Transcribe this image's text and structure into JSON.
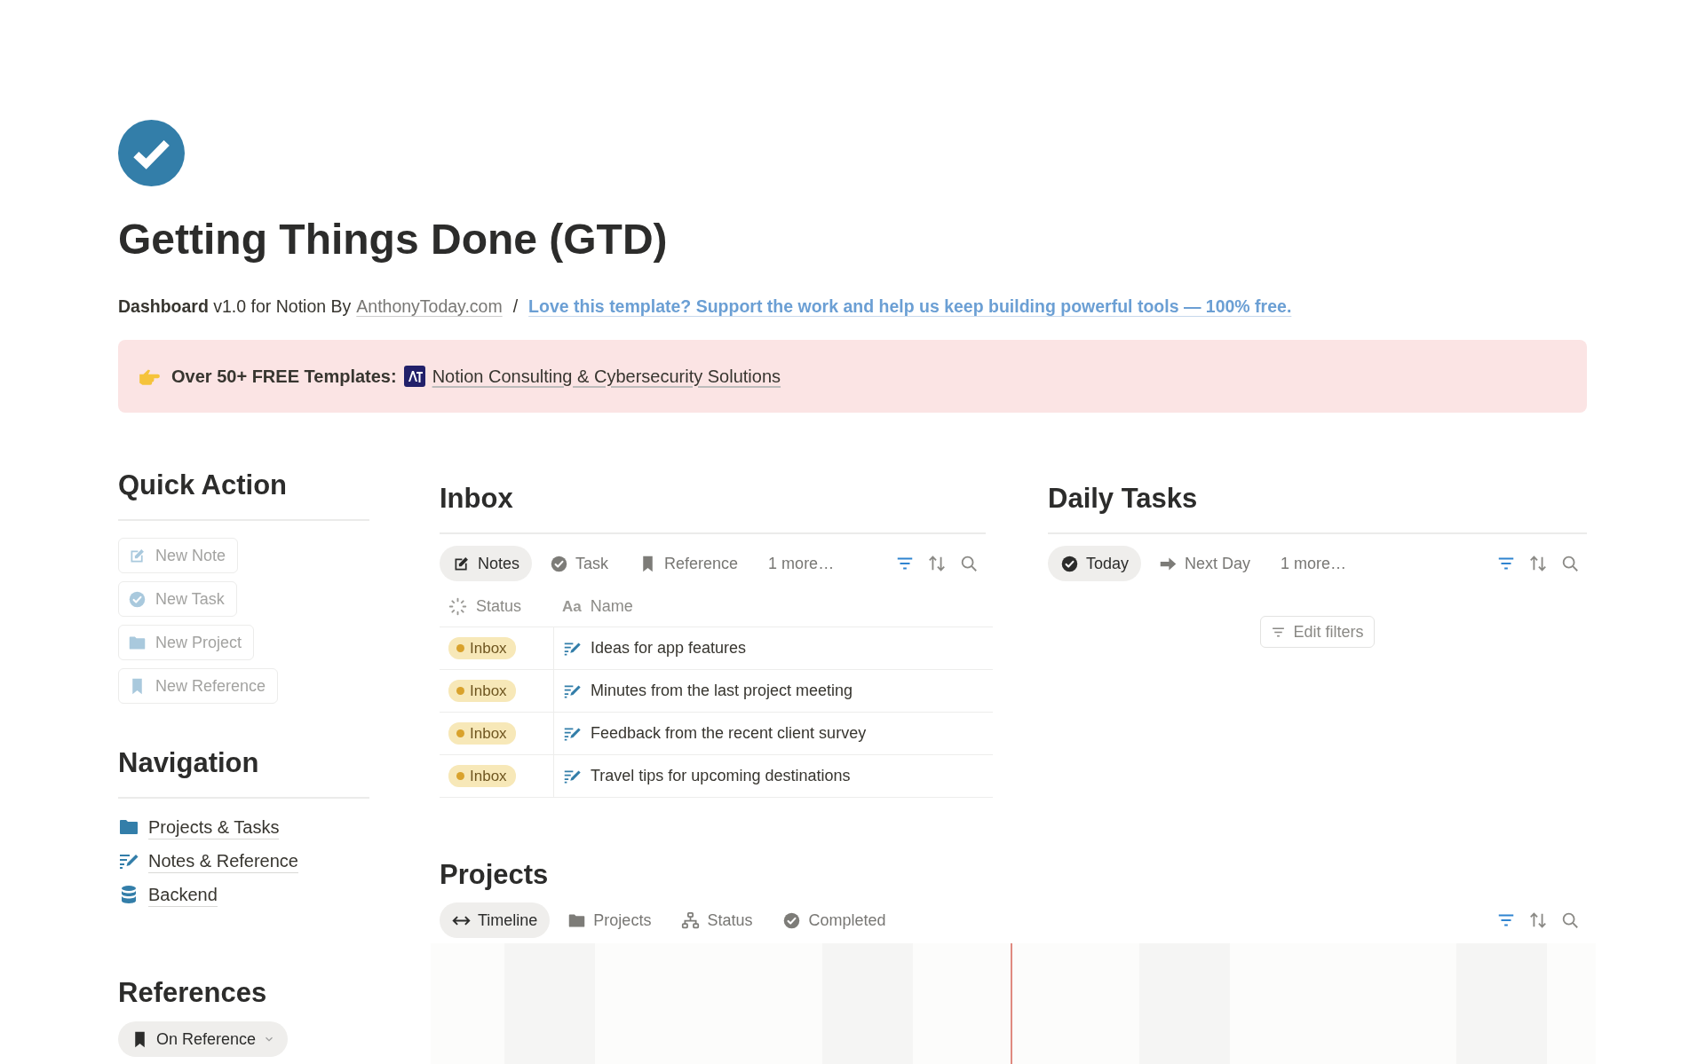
{
  "page": {
    "title": "Getting Things Done (GTD)"
  },
  "subtitle": {
    "bold": "Dashboard",
    "text": "v1.0 for Notion By",
    "author_link": "AnthonyToday.com",
    "separator": "/",
    "support_link": "Love this template? Support the work and help us keep building powerful tools — 100% free."
  },
  "callout": {
    "label": "Over 50+ FREE Templates:",
    "link": "Notion Consulting & Cybersecurity Solutions"
  },
  "quick_action": {
    "heading": "Quick Action",
    "buttons": [
      "New Note",
      "New Task",
      "New Project",
      "New Reference"
    ]
  },
  "navigation": {
    "heading": "Navigation",
    "items": [
      "Projects & Tasks",
      "Notes & Reference",
      "Backend"
    ]
  },
  "references": {
    "heading": "References",
    "views": [
      {
        "label": "On Reference",
        "selected": true
      }
    ]
  },
  "inbox": {
    "heading": "Inbox",
    "views": [
      {
        "label": "Notes",
        "selected": true
      },
      {
        "label": "Task",
        "selected": false
      },
      {
        "label": "Reference",
        "selected": false
      }
    ],
    "more": "1 more…",
    "columns": [
      {
        "label": "Status"
      },
      {
        "type_mark": "Aa",
        "label": "Name"
      }
    ],
    "rows": [
      {
        "status": "Inbox",
        "name": "Ideas for app features"
      },
      {
        "status": "Inbox",
        "name": "Minutes from the last project meeting"
      },
      {
        "status": "Inbox",
        "name": "Feedback from the recent client survey"
      },
      {
        "status": "Inbox",
        "name": "Travel tips for upcoming destinations"
      }
    ]
  },
  "daily_tasks": {
    "heading": "Daily Tasks",
    "views": [
      {
        "label": "Today",
        "selected": true
      },
      {
        "label": "Next Day",
        "selected": false
      }
    ],
    "more": "1 more…",
    "edit_filters": "Edit filters"
  },
  "projects": {
    "heading": "Projects",
    "views": [
      {
        "label": "Timeline",
        "selected": true
      },
      {
        "label": "Projects",
        "selected": false
      },
      {
        "label": "Status",
        "selected": false
      },
      {
        "label": "Completed",
        "selected": false
      }
    ]
  }
}
